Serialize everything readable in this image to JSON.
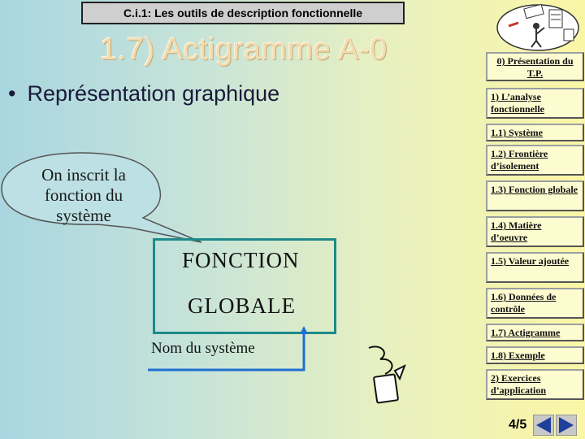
{
  "header": {
    "title": "C.i.1: Les outils de description fonctionnelle"
  },
  "slide": {
    "title": "1.7) Actigramme A-0",
    "bullet": "Représentation graphique",
    "callout_lines": [
      "On inscrit la",
      "fonction du",
      "système"
    ],
    "function_lines": [
      "FONCTION",
      "GLOBALE"
    ],
    "system_label": "Nom du système"
  },
  "nav": {
    "items": [
      {
        "label": "0) Présentation du T.P.",
        "centered": true
      },
      {
        "label": "1) L’analyse fonctionnelle",
        "centered": false
      },
      {
        "label": "1.1) Système",
        "centered": false
      },
      {
        "label": "1.2) Frontière d’isolement",
        "centered": false
      },
      {
        "label": "1.3) Fonction globale",
        "centered": false
      },
      {
        "label": "1.4) Matière d’oeuvre",
        "centered": false
      },
      {
        "label": "1.5) Valeur ajoutée",
        "centered": false
      },
      {
        "label": "1.6) Données de contrôle",
        "centered": false
      },
      {
        "label": "1.7) Actigramme",
        "centered": false
      },
      {
        "label": "1.8) Exemple",
        "centered": false
      },
      {
        "label": "2) Exercices d’application",
        "centered": false
      }
    ]
  },
  "pager": {
    "page": "4/5"
  },
  "colors": {
    "accent_teal": "#1d8a8a",
    "nav_bg": "#fdfbd0",
    "arrow_blue": "#1f6fd0"
  },
  "icons": [
    "mascot-logo-icon",
    "pencil-paper-icon",
    "prev-arrow-icon",
    "next-arrow-icon"
  ]
}
